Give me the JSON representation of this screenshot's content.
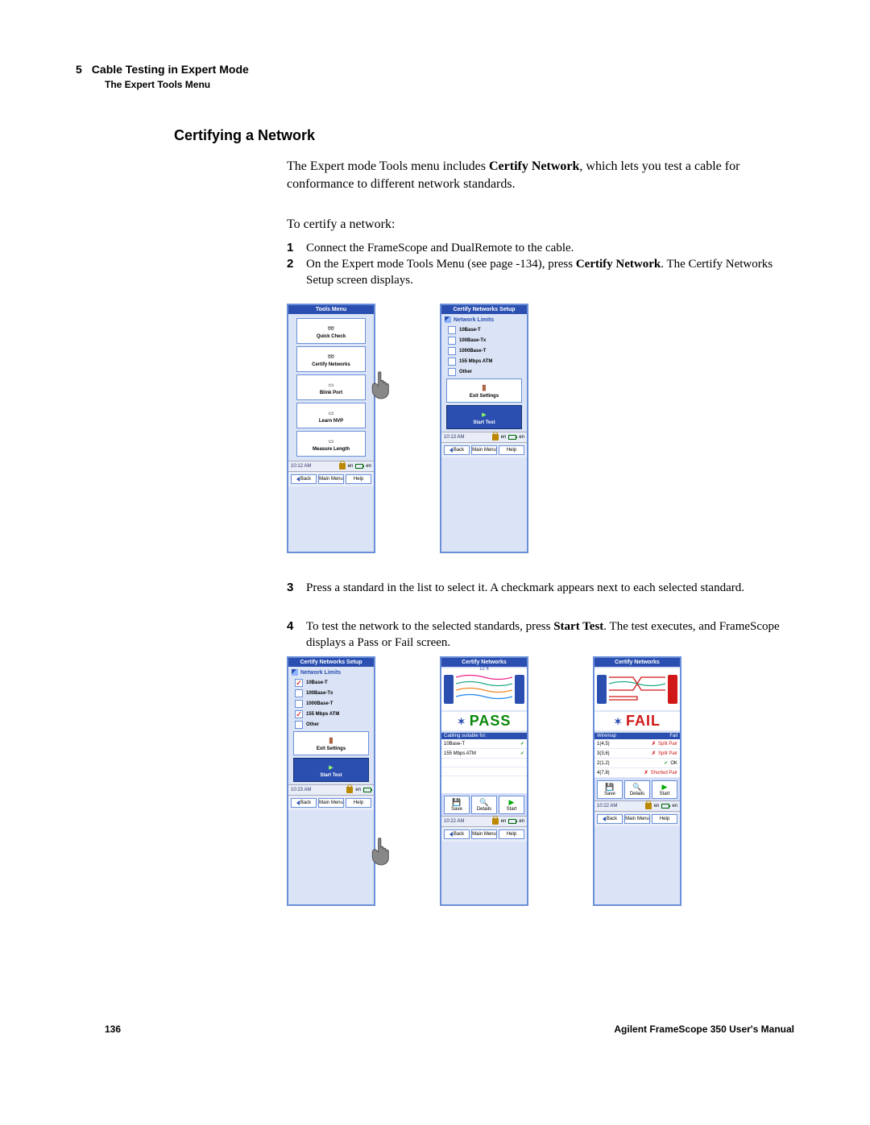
{
  "header": {
    "chapter_num": "5",
    "chapter_title": "Cable Testing in Expert Mode",
    "sub": "The Expert Tools Menu"
  },
  "section_title": "Certifying a Network",
  "para1_a": "The Expert mode Tools menu includes ",
  "para1_b": "Certify Network",
  "para1_c": ", which lets you test a cable for conformance to different network standards.",
  "para2": "To certify a network:",
  "steps": {
    "s1n": "1",
    "s1t": "Connect the FrameScope and DualRemote to the cable.",
    "s2n": "2",
    "s2ta": "On the Expert mode Tools Menu (see page -134), press ",
    "s2tb": "Certify Network",
    "s2tc": ". The Certify Networks Setup screen displays.",
    "s3n": "3",
    "s3t": "Press a standard in the list to select it. A checkmark appears next to each selected standard.",
    "s4n": "4",
    "s4ta": "To test the network to the selected standards, press ",
    "s4tb": "Start Test",
    "s4tc": ". The test executes, and FrameScope displays a Pass or Fail screen."
  },
  "footer": {
    "page": "136",
    "manual": "Agilent FrameScope 350 User's Manual"
  },
  "devices": {
    "tools_menu": {
      "title": "Tools Menu",
      "items": [
        "Quick Check",
        "Certify Networks",
        "Blink Port",
        "Learn NVP",
        "Measure Length"
      ],
      "time": "10:12 AM",
      "back": "Back",
      "main": "Main Menu",
      "help": "Help"
    },
    "setup": {
      "title": "Certify Networks Setup",
      "section": "Network Limits",
      "limits": [
        "10Base-T",
        "100Base-Tx",
        "1000Base-T",
        "155 Mbps ATM",
        "Other"
      ],
      "exit": "Exit Settings",
      "start": "Start Test",
      "time": "10:13 AM",
      "back": "Back",
      "main": "Main Menu",
      "help": "Help"
    },
    "setup2": {
      "title": "Certify Networks Setup",
      "section": "Network Limits",
      "limits": [
        "10Base-T",
        "100Base-Tx",
        "1000Base-T",
        "155 Mbps ATM",
        "Other"
      ],
      "checked": [
        0,
        3
      ],
      "exit": "Exit Settings",
      "start": "Start Test",
      "time": "10:23 AM",
      "back": "Back",
      "main": "Main Menu",
      "help": "Help"
    },
    "pass": {
      "title": "Certify Networks",
      "length": "12 ft",
      "badge": "PASS",
      "list_header": "Cabling suitable for:",
      "rows": [
        {
          "name": "10Base-T",
          "ok": true
        },
        {
          "name": "155 Mbps ATM",
          "ok": true
        }
      ],
      "btns": [
        "Save",
        "Details",
        "Start"
      ],
      "time": "10:22 AM",
      "back": "Back",
      "main": "Main Menu",
      "help": "Help"
    },
    "fail": {
      "title": "Certify Networks",
      "badge": "FAIL",
      "header_cols": [
        "Wiremap",
        "Fail"
      ],
      "rows": [
        {
          "pair": "1(4,5)",
          "ok": false,
          "msg": "Split Pair"
        },
        {
          "pair": "3(3,6)",
          "ok": false,
          "msg": "Split Pair"
        },
        {
          "pair": "2(1,2)",
          "ok": true,
          "msg": "OK"
        },
        {
          "pair": "4(7,8)",
          "ok": false,
          "msg": "Shorted Pair"
        }
      ],
      "btns": [
        "Save",
        "Details",
        "Start"
      ],
      "time": "10:22 AM",
      "back": "Back",
      "main": "Main Menu",
      "help": "Help"
    }
  }
}
